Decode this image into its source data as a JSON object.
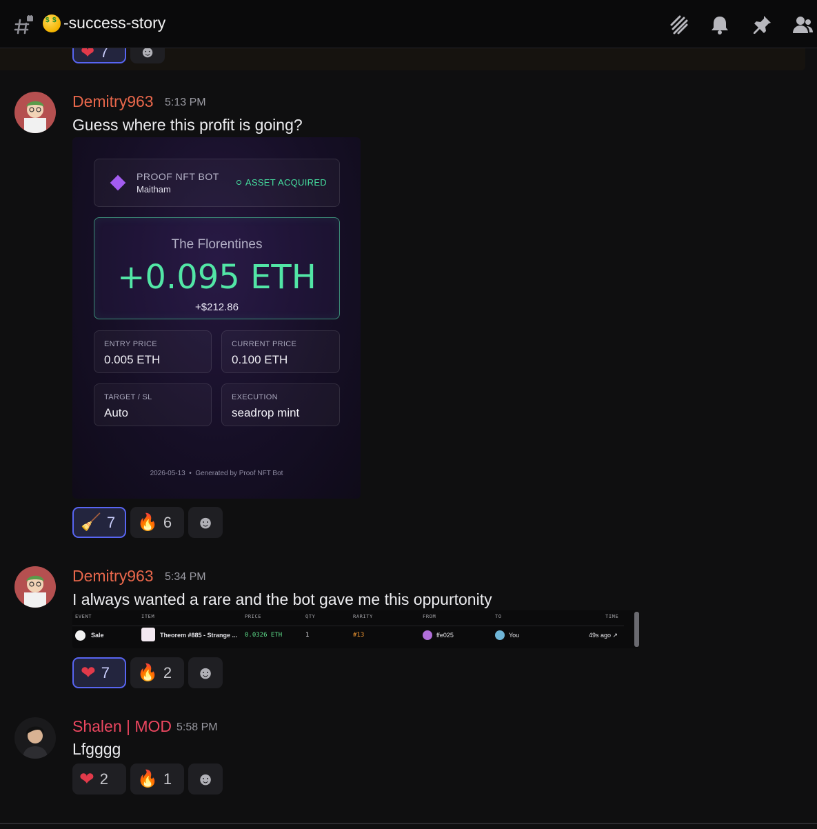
{
  "header": {
    "channel_name": "-success-story",
    "icons": [
      "channel-hash-icon",
      "threads-icon",
      "bell-icon",
      "pin-icon",
      "members-icon"
    ]
  },
  "prev_message": {
    "reactions": [
      {
        "emoji": "heart",
        "count": "7",
        "active": true
      },
      {
        "emoji": "add-reaction",
        "count": ""
      }
    ]
  },
  "messages": [
    {
      "username": "Demitry963",
      "username_color": "#e8674b",
      "time": "5:13 PM",
      "text": "Guess where this profit is going?",
      "reactions": [
        {
          "emoji": "broom",
          "count": "7",
          "active": true
        },
        {
          "emoji": "fire",
          "count": "6",
          "active": false
        }
      ]
    },
    {
      "username": "Demitry963",
      "username_color": "#e8674b",
      "time": "5:34 PM",
      "text": "I always wanted a rare and the bot gave me this oppurtonity",
      "reactions": [
        {
          "emoji": "heart",
          "count": "7",
          "active": true
        },
        {
          "emoji": "fire",
          "count": "2",
          "active": false
        }
      ]
    },
    {
      "username": "Shalen | MOD",
      "username_color": "#ec4760",
      "time": "5:58 PM",
      "text": "Lfgggg",
      "reactions": [
        {
          "emoji": "heart",
          "count": "2",
          "active": false
        },
        {
          "emoji": "fire",
          "count": "1",
          "active": false
        }
      ]
    }
  ],
  "nft_card": {
    "bot_title": "PROOF NFT BOT",
    "bot_user": "Maitham",
    "status": "ASSET ACQUIRED",
    "collection": "The Florentines",
    "profit_eth": "+0.095 ETH",
    "profit_usd": "+$212.86",
    "stats": [
      {
        "label": "ENTRY PRICE",
        "value": "0.005 ETH"
      },
      {
        "label": "CURRENT PRICE",
        "value": "0.100 ETH"
      },
      {
        "label": "TARGET / SL",
        "value": "Auto"
      },
      {
        "label": "EXECUTION",
        "value": "seadrop mint"
      }
    ],
    "footer": "2026-05-13  •  Generated by Proof NFT Bot",
    "colors": {
      "accent_green": "#52e6a6",
      "diamond": "#a35cf0"
    }
  },
  "sale_table": {
    "headers": [
      "EVENT",
      "ITEM",
      "PRICE",
      "QTY",
      "RARITY",
      "FROM",
      "TO",
      "TIME"
    ],
    "row": {
      "event": "Sale",
      "item": "Theorem #885 - Strange ...",
      "price": "0.0326 ETH",
      "qty": "1",
      "rarity": "#13",
      "from": "ffe025",
      "to": "You",
      "time": "49s ago ↗"
    }
  }
}
